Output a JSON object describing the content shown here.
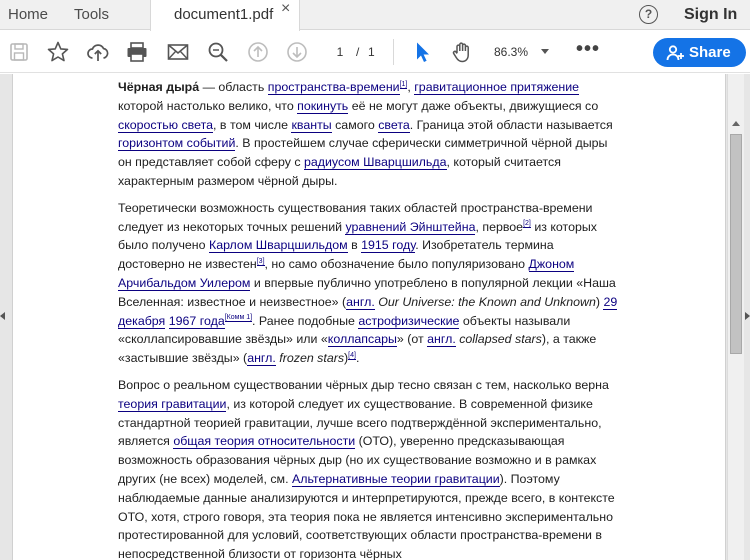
{
  "tabs": {
    "home": "Home",
    "tools": "Tools",
    "document": "document1.pdf",
    "close": "×"
  },
  "header": {
    "help": "?",
    "signin": "Sign In"
  },
  "toolbar": {
    "icons": [
      "save-icon",
      "star-icon",
      "upload-icon",
      "print-icon",
      "mail-icon",
      "zoom-search-icon",
      "page-up-icon",
      "page-down-icon",
      "cursor-icon",
      "hand-icon"
    ],
    "page_current": "1",
    "page_separator": "/",
    "page_total": "1",
    "zoom": "86.3%",
    "more": "•••",
    "share": "Share",
    "accent_color": "#1473e6"
  },
  "document": {
    "p1": {
      "t1": "Чёрная дыра́",
      "t2": " — область ",
      "l1": "пространства-времени",
      "s1": "[1]",
      "t3": ", ",
      "l2": "гравитационное притяжение",
      "t4": " которой настолько велико, что ",
      "l3": "покинуть",
      "t5": " её не могут даже объекты, движущиеся со ",
      "l4": "скоростью света",
      "t6": ", в том числе ",
      "l5": "кванты",
      "t7": " самого ",
      "l6": "света",
      "t8": ". Граница этой области называется ",
      "l7": "горизонтом событий",
      "t9": ". В простейшем случае сферически симметричной чёрной дыры он представляет собой сферу с ",
      "l8": "радиусом Шварцшильда",
      "t10": ", который считается характерным размером чёрной дыры."
    },
    "p2": {
      "t1": "Теоретически возможность существования таких областей пространства-времени следует из некоторых точных решений ",
      "l1": "уравнений Эйнштейна",
      "t2": ", первое",
      "s1": "[2]",
      "t3": " из которых было получено ",
      "l2": "Карлом Шварцшильдом",
      "t4": " в ",
      "l3": "1915 году",
      "t5": ". Изобретатель термина достоверно не известен",
      "s2": "[3]",
      "t6": ", но само обозначение было популяризовано ",
      "l4": "Джоном Арчибальдом Уилером",
      "t7": " и впервые публично употреблено в популярной лекции «Наша Вселенная: известное и неизвестное» (",
      "l5": "англ.",
      "t8": " ",
      "i1": "Our Universe: the Known and Unknown",
      "t9": ") ",
      "l6": "29 декабря",
      "t10": " ",
      "l7": "1967 года",
      "s3": "[Комм 1]",
      "t11": ". Ранее подобные ",
      "l8": "астрофизические",
      "t12": " объекты называли «сколлапсировавшие звёзды» или «",
      "l9": "коллапсары",
      "t13": "» (от ",
      "l10": "англ.",
      "t14": " ",
      "i2": "collapsed stars",
      "t15": "), а также «застывшие звёзды» (",
      "l11": "англ.",
      "t16": " ",
      "i3": "frozen stars",
      "t17": ")",
      "s4": "[4]",
      "t18": "."
    },
    "p3": {
      "t1": "Вопрос о реальном существовании чёрных дыр тесно связан с тем, насколько верна ",
      "l1": "теория гравитации",
      "t2": ", из которой следует их существование. В современной физике стандартной теорией гравитации, лучше всего подтверждённой экспериментально, является ",
      "l2": "общая теория относительности",
      "t3": " (ОТО), уверенно предсказывающая возможность образования чёрных дыр (но их существование возможно и в рамках других (не всех) моделей, см. ",
      "l3": "Альтернативные теории гравитации",
      "t4": "). Поэтому наблюдаемые данные анализируются и интерпретируются, прежде всего, в контексте ОТО, хотя, строго говоря, эта теория пока не является интенсивно экспериментально протестированной для условий, соответствующих области пространства-времени в непосредственной близости от горизонта чёрных"
    }
  }
}
